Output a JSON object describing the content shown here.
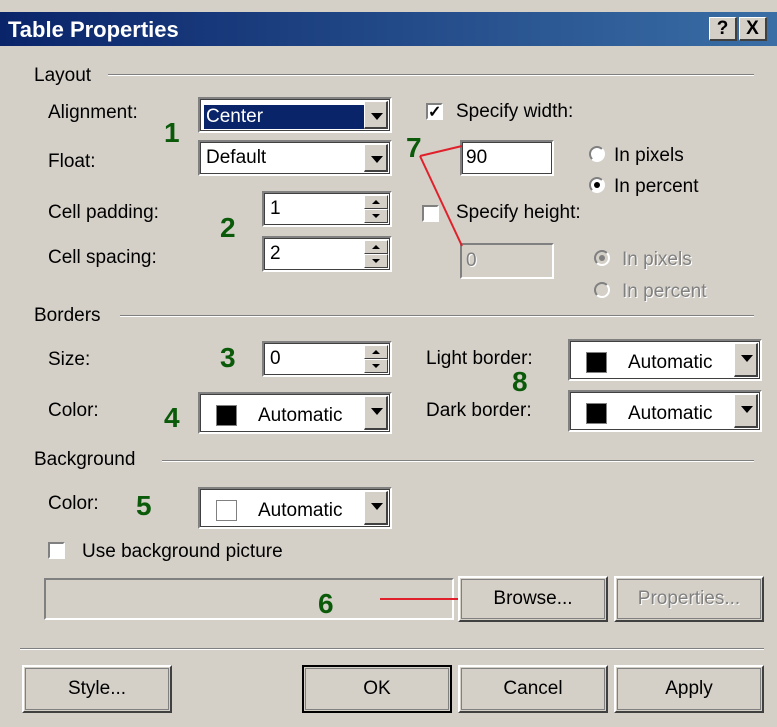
{
  "window": {
    "title": "Table Properties",
    "help_label": "?",
    "close_label": "X"
  },
  "layout": {
    "section_label": "Layout",
    "alignment_label": "Alignment:",
    "alignment_value": "Center",
    "float_label": "Float:",
    "float_value": "Default",
    "cell_padding_label": "Cell padding:",
    "cell_padding_value": "1",
    "cell_spacing_label": "Cell spacing:",
    "cell_spacing_value": "2",
    "specify_width_label": "Specify width:",
    "specify_width_checked": true,
    "width_value": "90",
    "width_in_pixels_label": "In pixels",
    "width_in_percent_label": "In percent",
    "width_unit": "percent",
    "specify_height_label": "Specify height:",
    "specify_height_checked": false,
    "height_value": "0",
    "height_in_pixels_label": "In pixels",
    "height_in_percent_label": "In percent",
    "height_unit": "pixels"
  },
  "borders": {
    "section_label": "Borders",
    "size_label": "Size:",
    "size_value": "0",
    "color_label": "Color:",
    "color_value": "Automatic",
    "light_border_label": "Light border:",
    "light_border_value": "Automatic",
    "dark_border_label": "Dark border:",
    "dark_border_value": "Automatic"
  },
  "background": {
    "section_label": "Background",
    "color_label": "Color:",
    "color_value": "Automatic",
    "use_picture_label": "Use background picture",
    "use_picture_checked": false,
    "picture_path": "",
    "browse_label": "Browse...",
    "properties_label": "Properties..."
  },
  "footer": {
    "style_label": "Style...",
    "ok_label": "OK",
    "cancel_label": "Cancel",
    "apply_label": "Apply"
  },
  "annotations": [
    "1",
    "2",
    "3",
    "4",
    "5",
    "6",
    "7",
    "8"
  ],
  "colors": {
    "titlebar_start": "#0a246a",
    "titlebar_end": "#3a6ea5",
    "dialog_bg": "#d4d0c8",
    "annotation_number": "#0a5a0a",
    "annotation_line": "#e0202a"
  }
}
